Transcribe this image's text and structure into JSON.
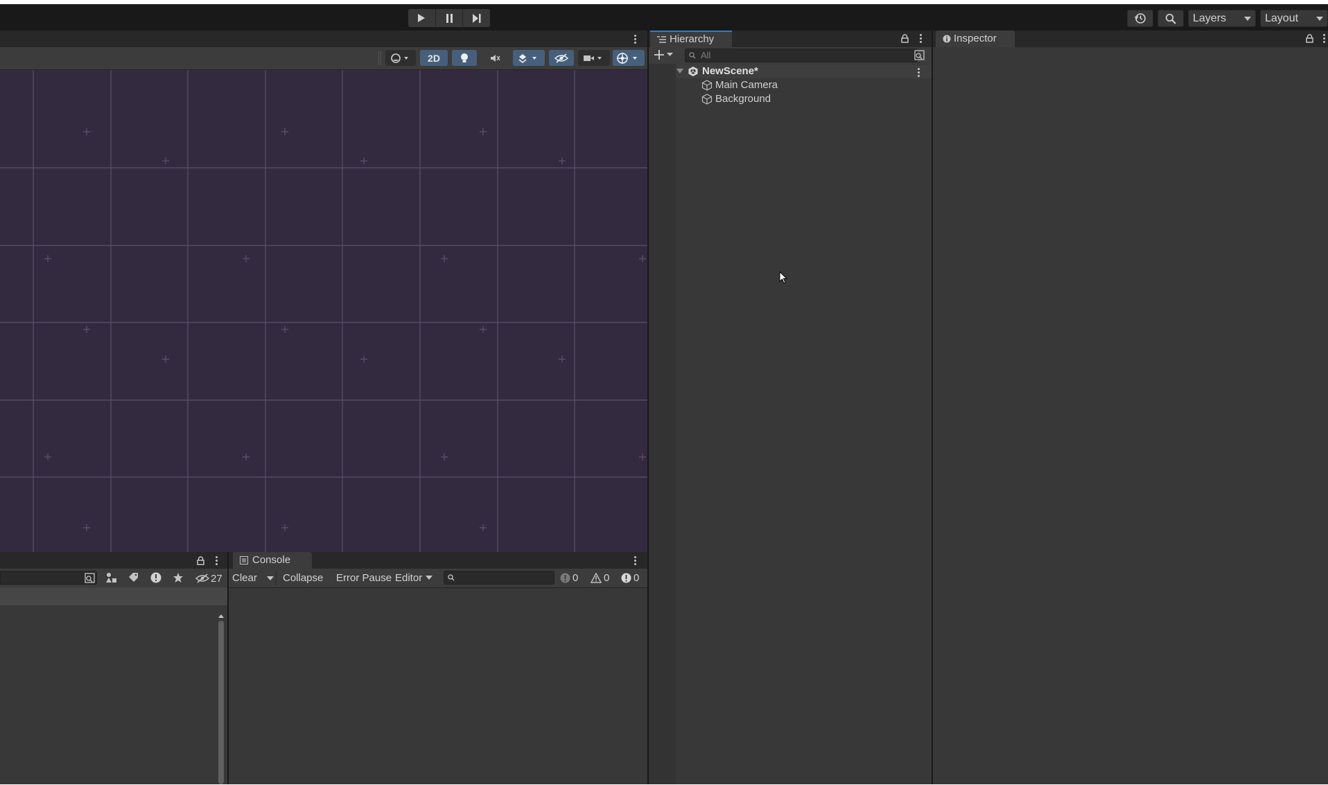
{
  "toolbar": {
    "play_controls": [
      "play-icon",
      "pause-icon",
      "step-icon"
    ],
    "history_icon": "history-icon",
    "search_icon": "search-icon",
    "layers_label": "Layers",
    "layout_label": "Layout"
  },
  "scene": {
    "mode_2d_label": "2D",
    "toolbar_icons": [
      "shading-mode-icon",
      "lighting-icon",
      "audio-icon",
      "effects-icon",
      "hidden-objects-icon",
      "camera-icon",
      "gizmos-icon"
    ]
  },
  "project": {
    "hidden_count": "27"
  },
  "console": {
    "tab_label": "Console",
    "clear_label": "Clear",
    "collapse_label": "Collapse",
    "error_pause_label": "Error Pause",
    "editor_label": "Editor",
    "info_count": "0",
    "warning_count": "0",
    "error_count": "0"
  },
  "hierarchy": {
    "tab_label": "Hierarchy",
    "search_placeholder": "All",
    "scene_name": "NewScene*",
    "items": [
      {
        "label": "Main Camera"
      },
      {
        "label": "Background"
      }
    ]
  },
  "inspector": {
    "tab_label": "Inspector"
  },
  "colors": {
    "scene_background": "#342a40",
    "grid_line": "#5a5068",
    "panel": "#383838",
    "accent": "#3a79bb",
    "toggle_active": "#46607c"
  }
}
